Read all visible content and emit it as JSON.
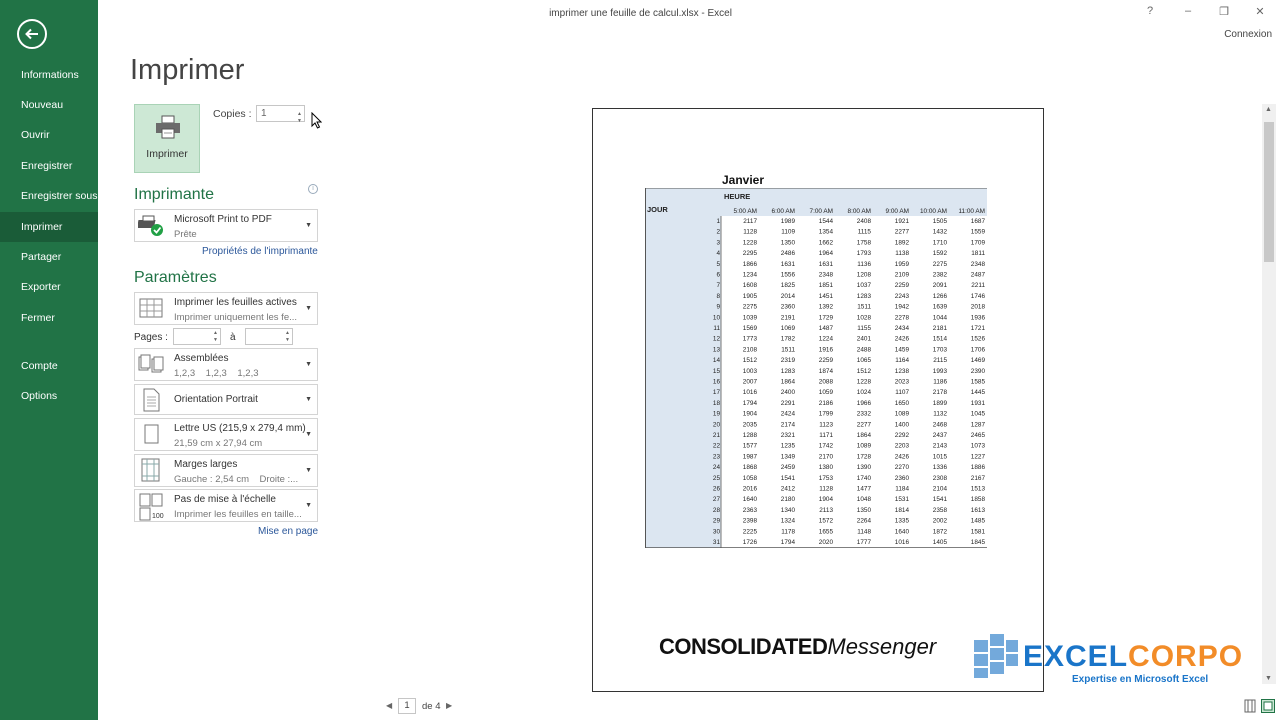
{
  "window": {
    "title": "imprimer une feuille de calcul.xlsx - Excel",
    "help": "?",
    "minimize": "–",
    "restore": "❐",
    "close": "✕",
    "signin": "Connexion"
  },
  "sidebar": {
    "items": [
      {
        "label": "Informations"
      },
      {
        "label": "Nouveau"
      },
      {
        "label": "Ouvrir"
      },
      {
        "label": "Enregistrer"
      },
      {
        "label": "Enregistrer sous"
      },
      {
        "label": "Imprimer"
      },
      {
        "label": "Partager"
      },
      {
        "label": "Exporter"
      },
      {
        "label": "Fermer"
      },
      {
        "label": "Compte"
      },
      {
        "label": "Options"
      }
    ],
    "active": "Imprimer"
  },
  "main": {
    "title": "Imprimer",
    "print_button": "Imprimer",
    "copies_label": "Copies :",
    "copies_value": "1",
    "printer_heading": "Imprimante",
    "printer_name": "Microsoft Print to PDF",
    "printer_status": "Prête",
    "printer_props": "Propriétés de l'imprimante",
    "settings_heading": "Paramètres",
    "settings": [
      {
        "l1": "Imprimer les feuilles actives",
        "l2": "Imprimer uniquement les fe..."
      },
      {
        "l1": "Assemblées",
        "l2": "1,2,3    1,2,3    1,2,3"
      },
      {
        "l1": "Orientation Portrait",
        "l2": ""
      },
      {
        "l1": "Lettre US (215,9 x 279,4 mm)",
        "l2": "21,59 cm x 27,94 cm"
      },
      {
        "l1": "Marges larges",
        "l2": "Gauche : 2,54 cm    Droite :..."
      },
      {
        "l1": "Pas de mise à l'échelle",
        "l2": "Imprimer les feuilles en taille..."
      }
    ],
    "pages_label": "Pages :",
    "pages_to": "à",
    "page_setup": "Mise en page"
  },
  "preview": {
    "sheet_title": "Janvier",
    "heure_label": "HEURE",
    "jour_label": "JOUR",
    "hours": [
      "5:00 AM",
      "6:00 AM",
      "7:00 AM",
      "8:00 AM",
      "9:00 AM",
      "10:00 AM",
      "11:00 AM"
    ],
    "rows": [
      [
        "1",
        "2117",
        "1989",
        "1544",
        "2408",
        "1921",
        "1505",
        "1687"
      ],
      [
        "2",
        "1128",
        "1109",
        "1354",
        "1115",
        "2277",
        "1432",
        "1559"
      ],
      [
        "3",
        "1228",
        "1350",
        "1662",
        "1758",
        "1892",
        "1710",
        "1709"
      ],
      [
        "4",
        "2295",
        "2486",
        "1964",
        "1793",
        "1138",
        "1592",
        "1811"
      ],
      [
        "5",
        "1866",
        "1631",
        "1631",
        "1136",
        "1959",
        "2275",
        "2348"
      ],
      [
        "6",
        "1234",
        "1556",
        "2348",
        "1208",
        "2109",
        "2382",
        "2487"
      ],
      [
        "7",
        "1608",
        "1825",
        "1851",
        "1037",
        "2259",
        "2091",
        "2211"
      ],
      [
        "8",
        "1905",
        "2014",
        "1451",
        "1283",
        "2243",
        "1266",
        "1746"
      ],
      [
        "9",
        "2275",
        "2360",
        "1392",
        "1511",
        "1942",
        "1639",
        "2018"
      ],
      [
        "10",
        "1039",
        "2191",
        "1729",
        "1028",
        "2278",
        "1044",
        "1936"
      ],
      [
        "11",
        "1569",
        "1069",
        "1487",
        "1155",
        "2434",
        "2181",
        "1721"
      ],
      [
        "12",
        "1773",
        "1782",
        "1224",
        "2401",
        "2426",
        "1514",
        "1526"
      ],
      [
        "13",
        "2108",
        "1511",
        "1916",
        "2488",
        "1459",
        "1703",
        "1706"
      ],
      [
        "14",
        "1512",
        "2319",
        "2259",
        "1065",
        "1164",
        "2115",
        "1469"
      ],
      [
        "15",
        "1003",
        "1283",
        "1874",
        "1512",
        "1238",
        "1993",
        "2390"
      ],
      [
        "16",
        "2007",
        "1864",
        "2088",
        "1228",
        "2023",
        "1186",
        "1585"
      ],
      [
        "17",
        "1016",
        "2400",
        "1059",
        "1024",
        "1107",
        "2178",
        "1445"
      ],
      [
        "18",
        "1794",
        "2291",
        "2186",
        "1966",
        "1650",
        "1899",
        "1931"
      ],
      [
        "19",
        "1904",
        "2424",
        "1799",
        "2332",
        "1089",
        "1132",
        "1045"
      ],
      [
        "20",
        "2035",
        "2174",
        "1123",
        "2277",
        "1400",
        "2468",
        "1287"
      ],
      [
        "21",
        "1288",
        "2321",
        "1171",
        "1864",
        "2292",
        "2437",
        "2465"
      ],
      [
        "22",
        "1577",
        "1235",
        "1742",
        "1089",
        "2203",
        "2143",
        "1073"
      ],
      [
        "23",
        "1987",
        "1349",
        "2170",
        "1728",
        "2426",
        "1015",
        "1227"
      ],
      [
        "24",
        "1868",
        "2459",
        "1380",
        "1390",
        "2270",
        "1336",
        "1886"
      ],
      [
        "25",
        "1058",
        "1541",
        "1753",
        "1740",
        "2360",
        "2308",
        "2167"
      ],
      [
        "26",
        "2016",
        "2412",
        "1128",
        "1477",
        "1184",
        "2104",
        "1513"
      ],
      [
        "27",
        "1640",
        "2180",
        "1904",
        "1048",
        "1531",
        "1541",
        "1858"
      ],
      [
        "28",
        "2363",
        "1340",
        "2113",
        "1350",
        "1814",
        "2358",
        "1613"
      ],
      [
        "29",
        "2398",
        "1324",
        "1572",
        "2264",
        "1335",
        "2002",
        "1485"
      ],
      [
        "30",
        "2225",
        "1178",
        "1655",
        "1148",
        "1640",
        "1872",
        "1581"
      ],
      [
        "31",
        "1726",
        "1794",
        "2020",
        "1777",
        "1016",
        "1405",
        "1845"
      ]
    ],
    "logo_bold": "CONSOLIDATED",
    "logo_italic": "Messenger",
    "watermark_name_a": "EXCEL",
    "watermark_name_b": "CORPO",
    "watermark_tag": "Expertise en Microsoft Excel",
    "page_current": "1",
    "page_of": "de 4"
  },
  "colors": {
    "sidebar": "#217346",
    "accent": "#217346",
    "header_fill": "#dce6f1"
  }
}
